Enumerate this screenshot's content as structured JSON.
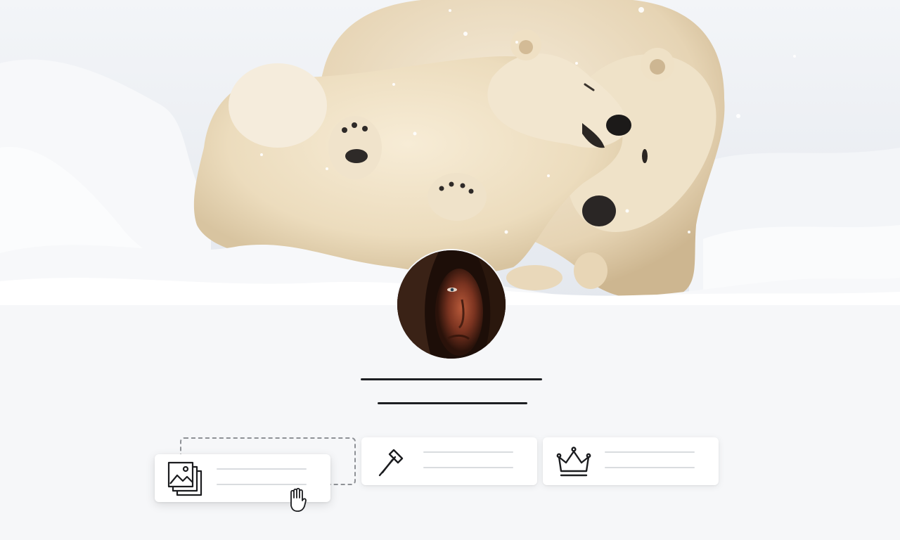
{
  "profile": {
    "cover_image": "polar-bears-in-snow-photo",
    "avatar_image": "man-in-fur-hood-portrait",
    "name": "",
    "subtitle": ""
  },
  "cards": [
    {
      "icon": "image-gallery-icon",
      "state": "dragging"
    },
    {
      "icon": "hammer-icon",
      "state": "idle"
    },
    {
      "icon": "crown-icon",
      "state": "idle"
    }
  ],
  "drop_slot": {
    "state": "empty"
  },
  "cursor": {
    "type": "grab-hand-icon"
  },
  "colors": {
    "page_background": "#f6f7f9",
    "card_background": "#ffffff",
    "placeholder_line_dark": "#1d1f23",
    "placeholder_line_light": "#d9dcdf",
    "dashed_border": "#8e9196"
  }
}
